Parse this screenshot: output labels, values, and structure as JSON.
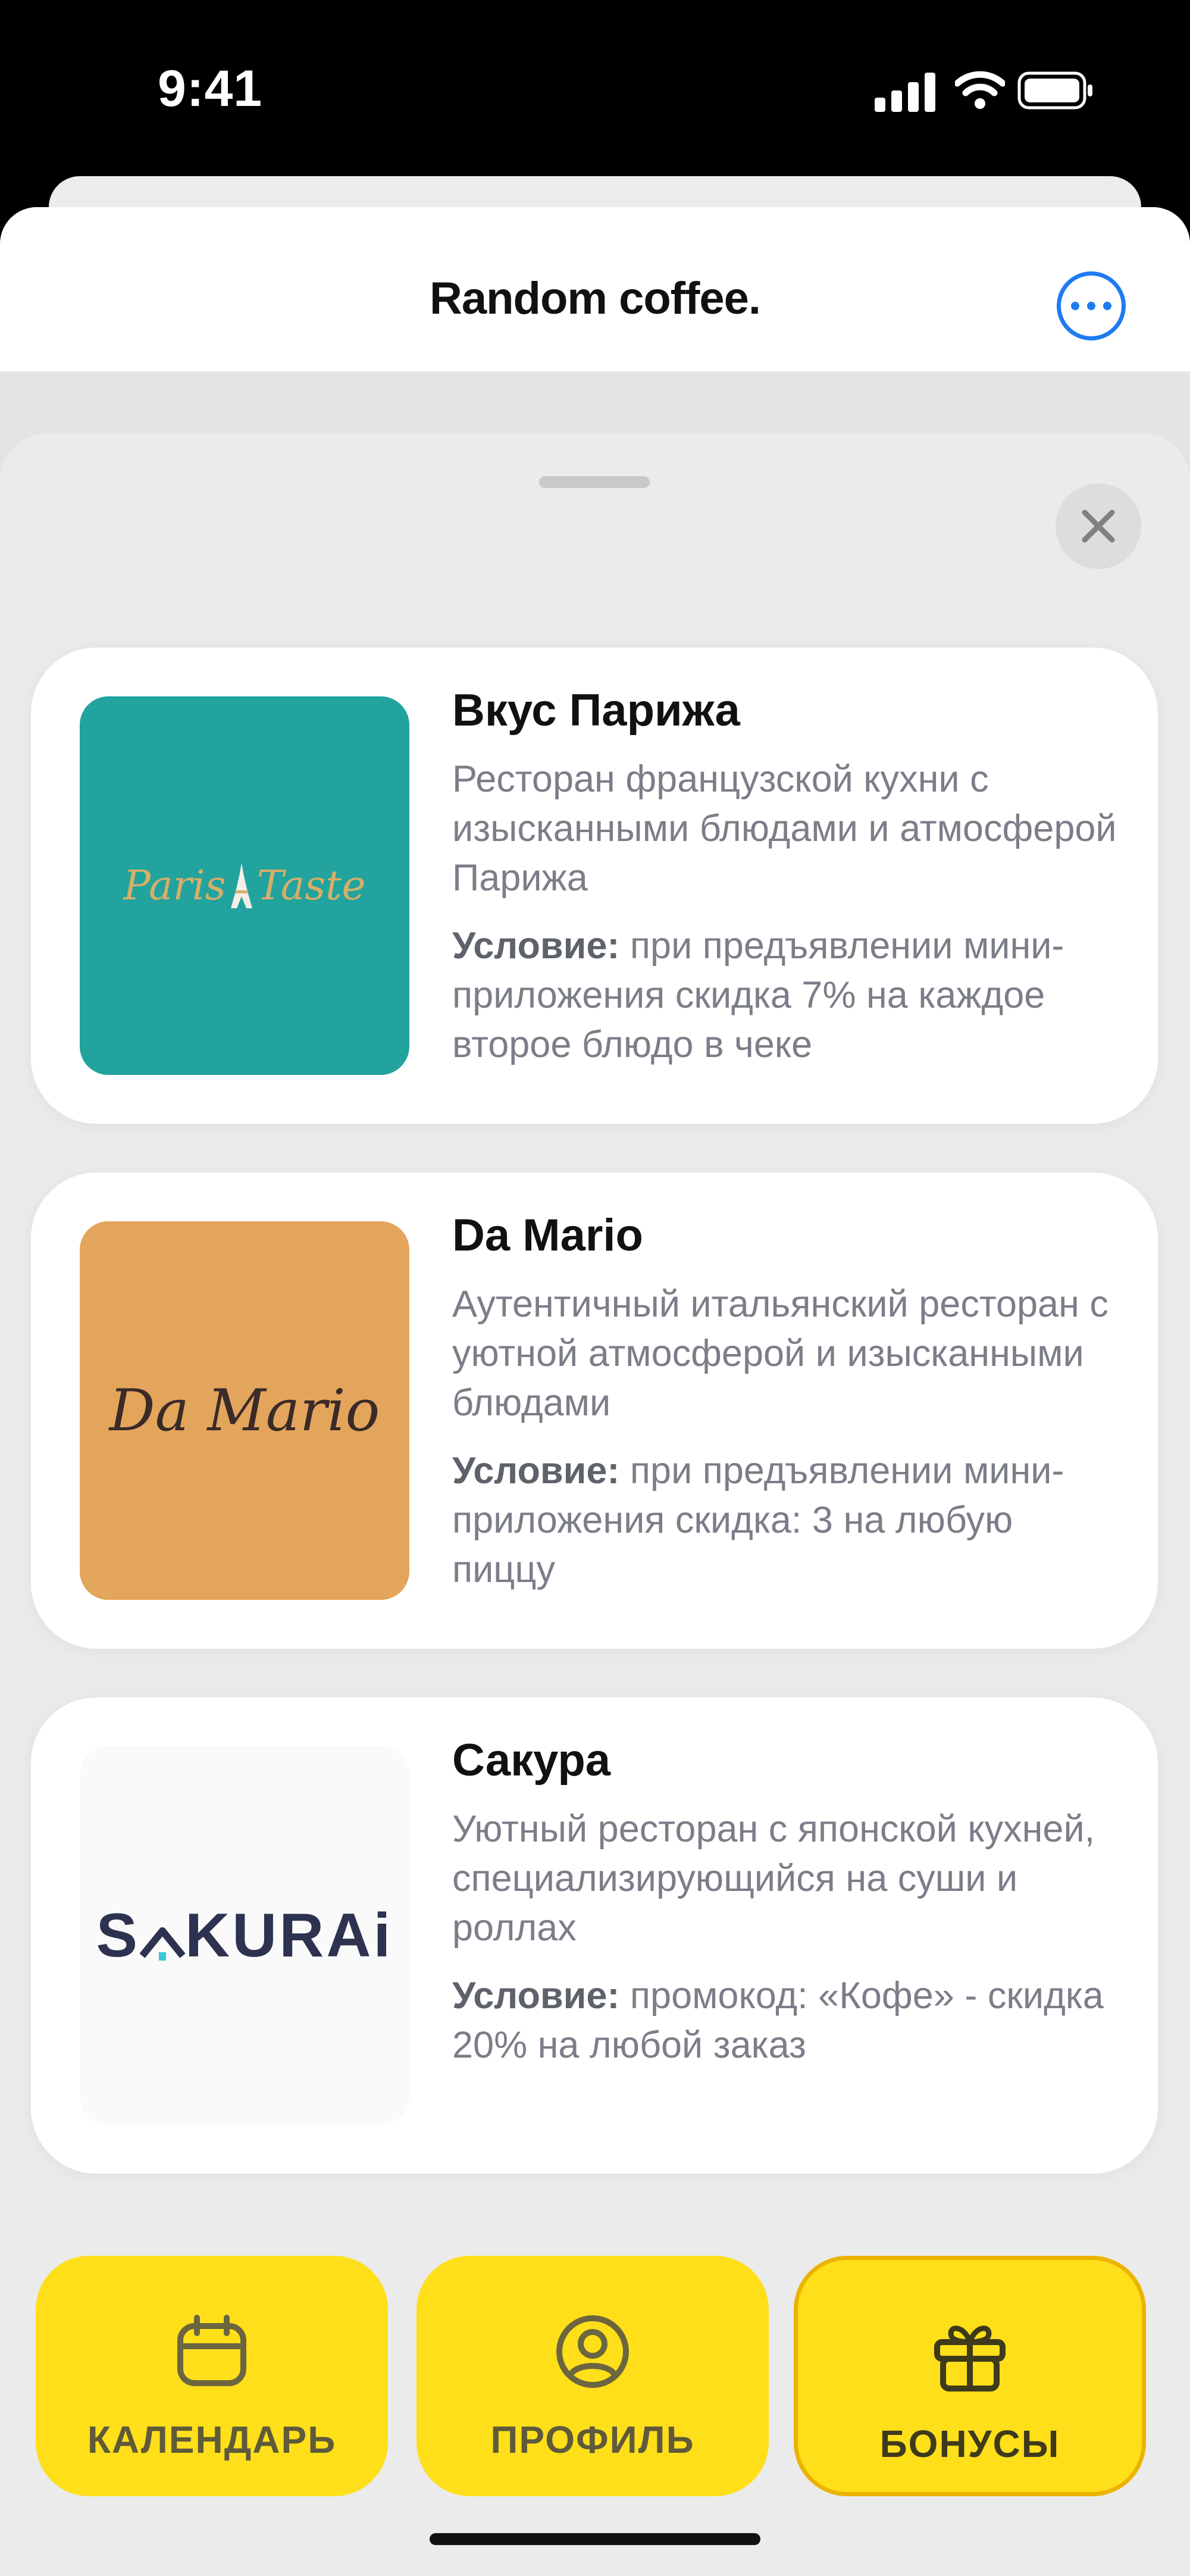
{
  "status_bar": {
    "time": "9:41"
  },
  "app": {
    "title": "Random coffee."
  },
  "restaurants": [
    {
      "name": "Вкус Парижа",
      "description": "Ресторан французской кухни с изысканными блюдами и атмосферой Парижа",
      "condition_label": "Условие:",
      "condition_text": " при предъявлении мини-приложения скидка 7% на каждое второе блюдо в чеке",
      "logo_text_left": "Paris",
      "logo_text_right": "Taste",
      "logo_bg": "#22a39d",
      "logo_color": "#d7ae69"
    },
    {
      "name": "Da Mario",
      "description": "Аутентичный итальянский ресторан с уютной атмосферой и изысканными блюдами",
      "condition_label": "Условие:",
      "condition_text": " при предъявлении мини-приложения скидка: 3 на любую пиццу",
      "logo_text": "Da Mario",
      "logo_bg": "#e3a55b",
      "logo_color": "#3a2a28"
    },
    {
      "name": "Сакура",
      "description": "Уютный ресторан с японской кухней, специализирующийся на суши и роллах",
      "condition_label": "Условие:",
      "condition_text": " промокод: «Кофе» - скидка 20% на любой заказ",
      "logo_text_a": "S",
      "logo_text_b": "KURA",
      "logo_text_c": "i",
      "logo_bg": "#fafafa",
      "logo_color": "#2d3250",
      "logo_accent": "#3cc6d9"
    }
  ],
  "tabs": [
    {
      "label": "КАЛЕНДАРЬ",
      "icon": "calendar-icon",
      "active": false
    },
    {
      "label": "ПРОФИЛЬ",
      "icon": "profile-icon",
      "active": false
    },
    {
      "label": "БОНУСЫ",
      "icon": "gift-icon",
      "active": true
    }
  ],
  "colors": {
    "accent": "#1f7cf0",
    "tab_bg": "#ffdf1a",
    "tab_active_border": "#ecb300"
  }
}
